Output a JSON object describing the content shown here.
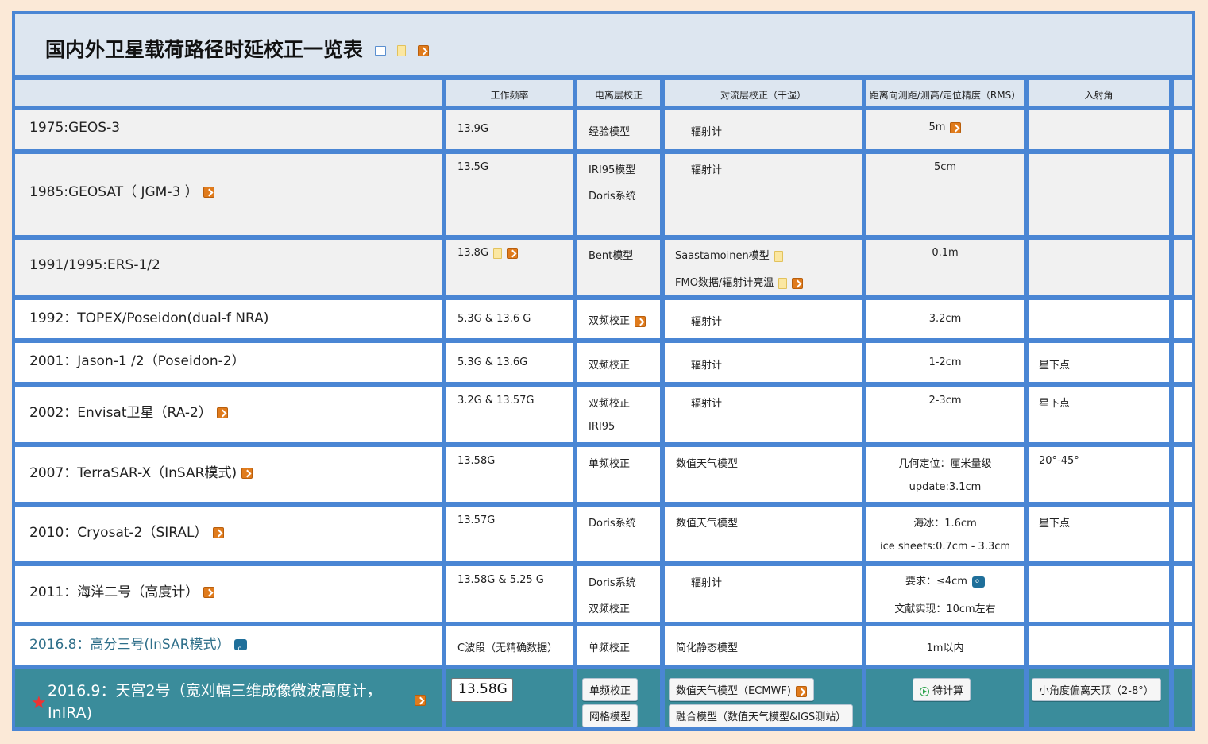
{
  "title": "国内外卫星载荷路径时延校正一览表",
  "headers": {
    "freq": "工作频率",
    "iono": "电离层校正",
    "tropo": "对流层校正（干湿）",
    "rms": "距离向测距/测高/定位精度（RMS）",
    "angle": "入射角"
  },
  "rows": [
    {
      "label": "1975:GEOS-3",
      "freq": "13.9G",
      "iono": [
        "经验模型"
      ],
      "tropo": [
        "辐射计"
      ],
      "rms": [
        "5m"
      ],
      "angle": ""
    },
    {
      "label": "1985:GEOSAT（ JGM-3 ）",
      "freq": "13.5G",
      "iono": [
        "IRI95模型",
        "Doris系统"
      ],
      "tropo": [
        "辐射计"
      ],
      "rms": [
        "5cm"
      ],
      "angle": ""
    },
    {
      "label": "1991/1995:ERS-1/2",
      "freq": "13.8G",
      "iono": [
        "Bent模型"
      ],
      "tropo": [
        "Saastamoinen模型",
        "FMO数据/辐射计亮温"
      ],
      "rms": [
        "0.1m"
      ],
      "angle": ""
    },
    {
      "label": "1992：TOPEX/Poseidon(dual-f NRA)",
      "freq": "5.3G & 13.6 G",
      "iono": [
        "双频校正"
      ],
      "tropo": [
        "辐射计"
      ],
      "rms": [
        "3.2cm"
      ],
      "angle": ""
    },
    {
      "label": "2001：Jason-1 /2（Poseidon-2）",
      "freq": "5.3G & 13.6G",
      "iono": [
        "双频校正"
      ],
      "tropo": [
        "辐射计"
      ],
      "rms": [
        "1-2cm"
      ],
      "angle": "星下点"
    },
    {
      "label": "2002：Envisat卫星（RA-2）",
      "freq": "3.2G & 13.57G",
      "iono": [
        "双频校正",
        "IRI95"
      ],
      "tropo": [
        "辐射计"
      ],
      "rms": [
        "2-3cm"
      ],
      "angle": "星下点"
    },
    {
      "label": "2007：TerraSAR-X（InSAR模式)",
      "freq": "13.58G",
      "iono": [
        "单频校正"
      ],
      "tropo": [
        "数值天气模型"
      ],
      "rms": [
        "几何定位：厘米量级",
        "update:3.1cm"
      ],
      "angle": "20°-45°"
    },
    {
      "label": "2010：Cryosat-2（SIRAL）",
      "freq": "13.57G",
      "iono": [
        "Doris系统"
      ],
      "tropo": [
        "数值天气模型"
      ],
      "rms": [
        "海冰：1.6cm",
        "ice sheets:0.7cm - 3.3cm"
      ],
      "angle": "星下点"
    },
    {
      "label": "2011：海洋二号（高度计）",
      "freq": "13.58G & 5.25 G",
      "iono": [
        "Doris系统",
        "双频校正"
      ],
      "tropo": [
        "辐射计"
      ],
      "rms": [
        "要求：≤4cm",
        "文献实现：10cm左右"
      ],
      "angle": ""
    },
    {
      "label": "2016.8：高分三号(InSAR模式）",
      "freq": "C波段（无精确数据）",
      "iono": [
        "单频校正"
      ],
      "tropo": [
        "简化静态模型"
      ],
      "rms": [
        "1m以内"
      ],
      "angle": ""
    }
  ],
  "last_row": {
    "label": "2016.9：天宫2号（宽刈幅三维成像微波高度计，InIRA)",
    "freq": "13.58G",
    "iono": [
      "单频校正",
      "网格模型"
    ],
    "tropo": [
      "数值天气模型（ECMWF)",
      "融合模型（数值天气模型&IGS测站）"
    ],
    "rms": "待计算",
    "angle": "小角度偏离天顶（2-8°）"
  },
  "icons": {
    "title": [
      "table-add-icon",
      "note-icon",
      "link-icon"
    ],
    "colors": {
      "frame": "#4a86d4",
      "teal": "#3a8c9b",
      "link_icon": "#e07b1c",
      "background": "#fbe9d7"
    }
  }
}
